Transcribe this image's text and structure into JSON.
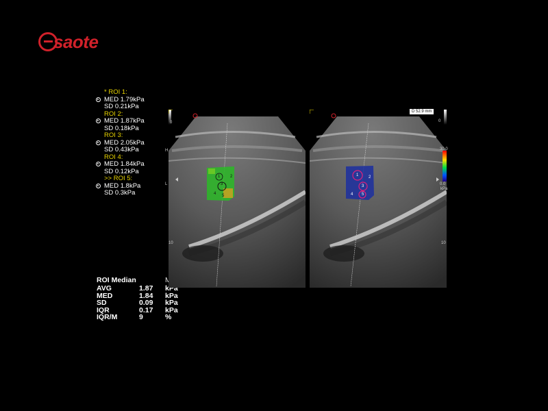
{
  "brand": {
    "logo_text": "saote",
    "logo_color": "#d0212a"
  },
  "rois": [
    {
      "title": "* ROI 1:",
      "med": "MED 1.79kPa",
      "sd": "SD  0.21kPa"
    },
    {
      "title": "ROI 2:",
      "med": "MED 1.87kPa",
      "sd": "SD  0.18kPa"
    },
    {
      "title": "ROI 3:",
      "med": "MED 2.05kPa",
      "sd": "SD  0.43kPa"
    },
    {
      "title": "ROI 4:",
      "med": "MED 1.84kPa",
      "sd": "SD  0.12kPa"
    },
    {
      "title": ">> ROI 5:",
      "med": "MED 1.8kPa",
      "sd": "SD  0.3kPa"
    }
  ],
  "median": {
    "title": "ROI Median",
    "organ": "MILZA",
    "rows": [
      {
        "label": "AVG",
        "value": "1.87",
        "unit": "kPa"
      },
      {
        "label": "MED",
        "value": "1.84",
        "unit": "kPa"
      },
      {
        "label": "SD",
        "value": "0.09",
        "unit": "kPa"
      },
      {
        "label": "IQR",
        "value": "0.17",
        "unit": "kPa"
      },
      {
        "label": "IQR/M",
        "value": "9",
        "unit": "%"
      }
    ]
  },
  "left_panel": {
    "scale_top": "0",
    "scale_h": "H",
    "scale_l": "L",
    "depth_mark": "10",
    "roi_numbers": [
      "1",
      "2",
      "3",
      "4",
      "5"
    ]
  },
  "right_panel": {
    "depth_badge": "D 52.9 mm",
    "scale_top": "0",
    "scale_max": "30.0",
    "scale_min": "0.0",
    "scale_unit": "kPa",
    "depth_mark": "10",
    "roi_numbers": [
      "1",
      "2",
      "3",
      "4",
      "5"
    ]
  },
  "colors": {
    "roi_title": "#e8d400",
    "elasto_green": "#2fb52a",
    "elasto_blue": "#1c2fa0",
    "roi_circle_right": "#e0207a"
  }
}
